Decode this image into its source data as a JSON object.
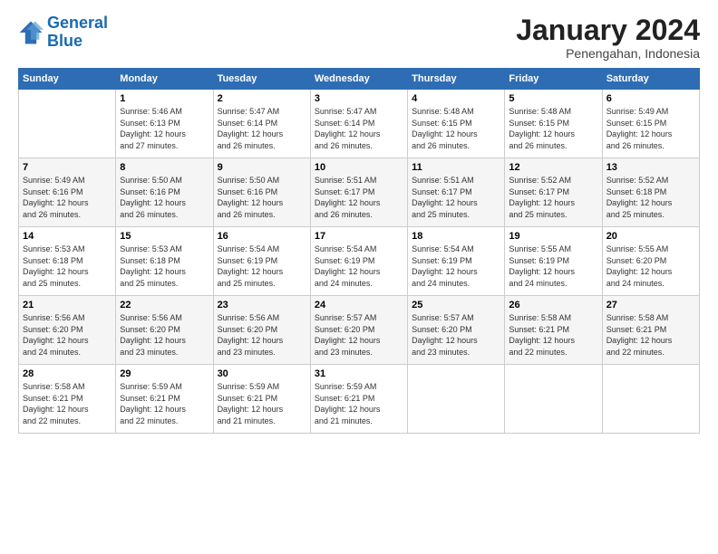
{
  "logo": {
    "line1": "General",
    "line2": "Blue"
  },
  "header": {
    "month": "January 2024",
    "location": "Penengahan, Indonesia"
  },
  "columns": [
    "Sunday",
    "Monday",
    "Tuesday",
    "Wednesday",
    "Thursday",
    "Friday",
    "Saturday"
  ],
  "weeks": [
    [
      {
        "day": "",
        "info": ""
      },
      {
        "day": "1",
        "info": "Sunrise: 5:46 AM\nSunset: 6:13 PM\nDaylight: 12 hours\nand 27 minutes."
      },
      {
        "day": "2",
        "info": "Sunrise: 5:47 AM\nSunset: 6:14 PM\nDaylight: 12 hours\nand 26 minutes."
      },
      {
        "day": "3",
        "info": "Sunrise: 5:47 AM\nSunset: 6:14 PM\nDaylight: 12 hours\nand 26 minutes."
      },
      {
        "day": "4",
        "info": "Sunrise: 5:48 AM\nSunset: 6:15 PM\nDaylight: 12 hours\nand 26 minutes."
      },
      {
        "day": "5",
        "info": "Sunrise: 5:48 AM\nSunset: 6:15 PM\nDaylight: 12 hours\nand 26 minutes."
      },
      {
        "day": "6",
        "info": "Sunrise: 5:49 AM\nSunset: 6:15 PM\nDaylight: 12 hours\nand 26 minutes."
      }
    ],
    [
      {
        "day": "7",
        "info": "Sunrise: 5:49 AM\nSunset: 6:16 PM\nDaylight: 12 hours\nand 26 minutes."
      },
      {
        "day": "8",
        "info": "Sunrise: 5:50 AM\nSunset: 6:16 PM\nDaylight: 12 hours\nand 26 minutes."
      },
      {
        "day": "9",
        "info": "Sunrise: 5:50 AM\nSunset: 6:16 PM\nDaylight: 12 hours\nand 26 minutes."
      },
      {
        "day": "10",
        "info": "Sunrise: 5:51 AM\nSunset: 6:17 PM\nDaylight: 12 hours\nand 26 minutes."
      },
      {
        "day": "11",
        "info": "Sunrise: 5:51 AM\nSunset: 6:17 PM\nDaylight: 12 hours\nand 25 minutes."
      },
      {
        "day": "12",
        "info": "Sunrise: 5:52 AM\nSunset: 6:17 PM\nDaylight: 12 hours\nand 25 minutes."
      },
      {
        "day": "13",
        "info": "Sunrise: 5:52 AM\nSunset: 6:18 PM\nDaylight: 12 hours\nand 25 minutes."
      }
    ],
    [
      {
        "day": "14",
        "info": "Sunrise: 5:53 AM\nSunset: 6:18 PM\nDaylight: 12 hours\nand 25 minutes."
      },
      {
        "day": "15",
        "info": "Sunrise: 5:53 AM\nSunset: 6:18 PM\nDaylight: 12 hours\nand 25 minutes."
      },
      {
        "day": "16",
        "info": "Sunrise: 5:54 AM\nSunset: 6:19 PM\nDaylight: 12 hours\nand 25 minutes."
      },
      {
        "day": "17",
        "info": "Sunrise: 5:54 AM\nSunset: 6:19 PM\nDaylight: 12 hours\nand 24 minutes."
      },
      {
        "day": "18",
        "info": "Sunrise: 5:54 AM\nSunset: 6:19 PM\nDaylight: 12 hours\nand 24 minutes."
      },
      {
        "day": "19",
        "info": "Sunrise: 5:55 AM\nSunset: 6:19 PM\nDaylight: 12 hours\nand 24 minutes."
      },
      {
        "day": "20",
        "info": "Sunrise: 5:55 AM\nSunset: 6:20 PM\nDaylight: 12 hours\nand 24 minutes."
      }
    ],
    [
      {
        "day": "21",
        "info": "Sunrise: 5:56 AM\nSunset: 6:20 PM\nDaylight: 12 hours\nand 24 minutes."
      },
      {
        "day": "22",
        "info": "Sunrise: 5:56 AM\nSunset: 6:20 PM\nDaylight: 12 hours\nand 23 minutes."
      },
      {
        "day": "23",
        "info": "Sunrise: 5:56 AM\nSunset: 6:20 PM\nDaylight: 12 hours\nand 23 minutes."
      },
      {
        "day": "24",
        "info": "Sunrise: 5:57 AM\nSunset: 6:20 PM\nDaylight: 12 hours\nand 23 minutes."
      },
      {
        "day": "25",
        "info": "Sunrise: 5:57 AM\nSunset: 6:20 PM\nDaylight: 12 hours\nand 23 minutes."
      },
      {
        "day": "26",
        "info": "Sunrise: 5:58 AM\nSunset: 6:21 PM\nDaylight: 12 hours\nand 22 minutes."
      },
      {
        "day": "27",
        "info": "Sunrise: 5:58 AM\nSunset: 6:21 PM\nDaylight: 12 hours\nand 22 minutes."
      }
    ],
    [
      {
        "day": "28",
        "info": "Sunrise: 5:58 AM\nSunset: 6:21 PM\nDaylight: 12 hours\nand 22 minutes."
      },
      {
        "day": "29",
        "info": "Sunrise: 5:59 AM\nSunset: 6:21 PM\nDaylight: 12 hours\nand 22 minutes."
      },
      {
        "day": "30",
        "info": "Sunrise: 5:59 AM\nSunset: 6:21 PM\nDaylight: 12 hours\nand 21 minutes."
      },
      {
        "day": "31",
        "info": "Sunrise: 5:59 AM\nSunset: 6:21 PM\nDaylight: 12 hours\nand 21 minutes."
      },
      {
        "day": "",
        "info": ""
      },
      {
        "day": "",
        "info": ""
      },
      {
        "day": "",
        "info": ""
      }
    ]
  ]
}
